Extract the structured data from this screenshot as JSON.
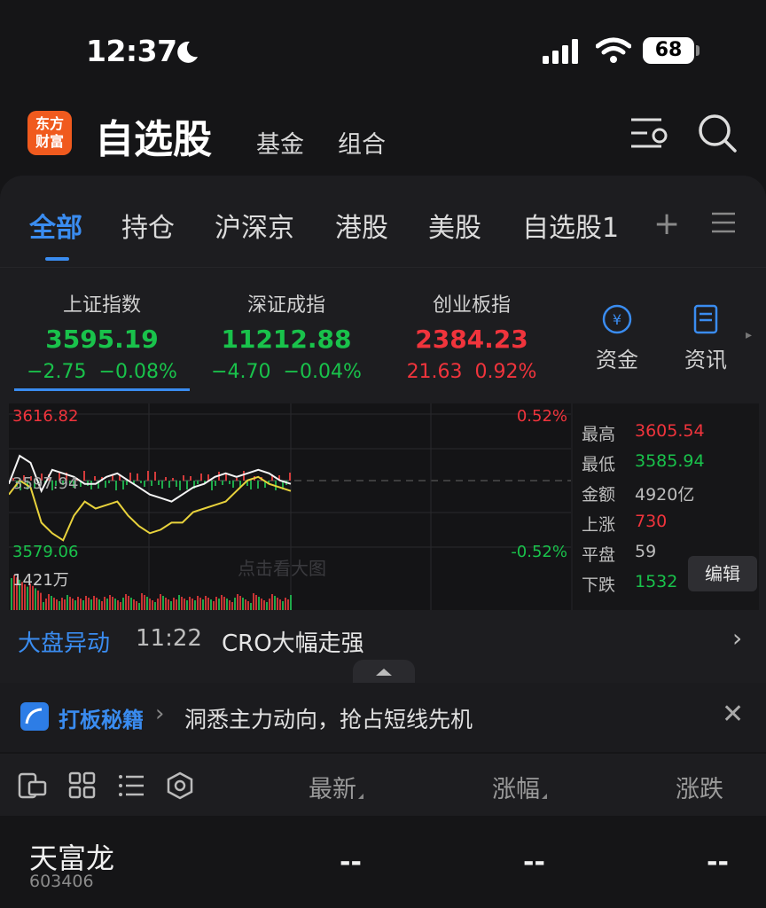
{
  "status_bar": {
    "time": "12:37",
    "battery": "68"
  },
  "header": {
    "logo": "东方财富",
    "logo_line1": "东方",
    "logo_line2": "财富",
    "title": "自选股",
    "tab_fund": "基金",
    "tab_combo": "组合"
  },
  "tabs": [
    "全部",
    "持仓",
    "沪深京",
    "港股",
    "美股",
    "自选股1"
  ],
  "tab_add": "+",
  "indices": [
    {
      "name": "上证指数",
      "value": "3595.19",
      "change": "−2.75",
      "pct": "−0.08%",
      "trend": "down"
    },
    {
      "name": "深证成指",
      "value": "11212.88",
      "change": "−4.70",
      "pct": "−0.04%",
      "trend": "down"
    },
    {
      "name": "创业板指",
      "value": "2384.23",
      "change": "21.63",
      "pct": "0.92%",
      "trend": "up"
    }
  ],
  "side_buttons": {
    "capital": "资金",
    "news": "资讯"
  },
  "chart": {
    "y_max": "3616.82",
    "y_mid": "3597.94",
    "y_min": "3579.06",
    "pct_max": "0.52%",
    "pct_min": "-0.52%",
    "volume": "1421万",
    "watermark": "点击看大图"
  },
  "chart_data": {
    "type": "line",
    "title": "",
    "ylim": [
      3579.06,
      3616.82
    ],
    "series": [
      {
        "values": [
          3597,
          3605,
          3603,
          3595,
          3601,
          3600,
          3599,
          3597,
          3597,
          3599,
          3600,
          3598,
          3596,
          3594,
          3593,
          3592,
          3594,
          3596,
          3597,
          3599,
          3600,
          3599,
          3600,
          3601,
          3600,
          3598,
          3597
        ]
      },
      {
        "values": [
          3594,
          3598,
          3596,
          3586,
          3583,
          3581,
          3588,
          3592,
          3590,
          3591,
          3592,
          3588,
          3585,
          3583,
          3584,
          3586,
          3586,
          3589,
          3590,
          3591,
          3592,
          3595,
          3598,
          3599,
          3597,
          3596,
          3595
        ]
      }
    ]
  },
  "stats": [
    {
      "label": "最高",
      "value": "3605.54",
      "color": "red"
    },
    {
      "label": "最低",
      "value": "3585.94",
      "color": "green"
    },
    {
      "label": "金额",
      "value": "4920亿",
      "color": "gray"
    },
    {
      "label": "上涨",
      "value": "730",
      "color": "red"
    },
    {
      "label": "平盘",
      "value": "59",
      "color": "gray"
    },
    {
      "label": "下跌",
      "value": "1532",
      "color": "green"
    }
  ],
  "edit_label": "编辑",
  "ticker": {
    "label": "大盘异动",
    "time": "11:22",
    "text": "CRO大幅走强"
  },
  "promo": {
    "title": "打板秘籍",
    "text": "洞悉主力动向，抢占短线先机"
  },
  "list_header": {
    "latest": "最新",
    "change_pct": "涨幅",
    "change": "涨跌"
  },
  "rows": [
    {
      "name": "天富龙",
      "code": "603406",
      "latest": "--",
      "change_pct": "--",
      "change": "--"
    }
  ]
}
